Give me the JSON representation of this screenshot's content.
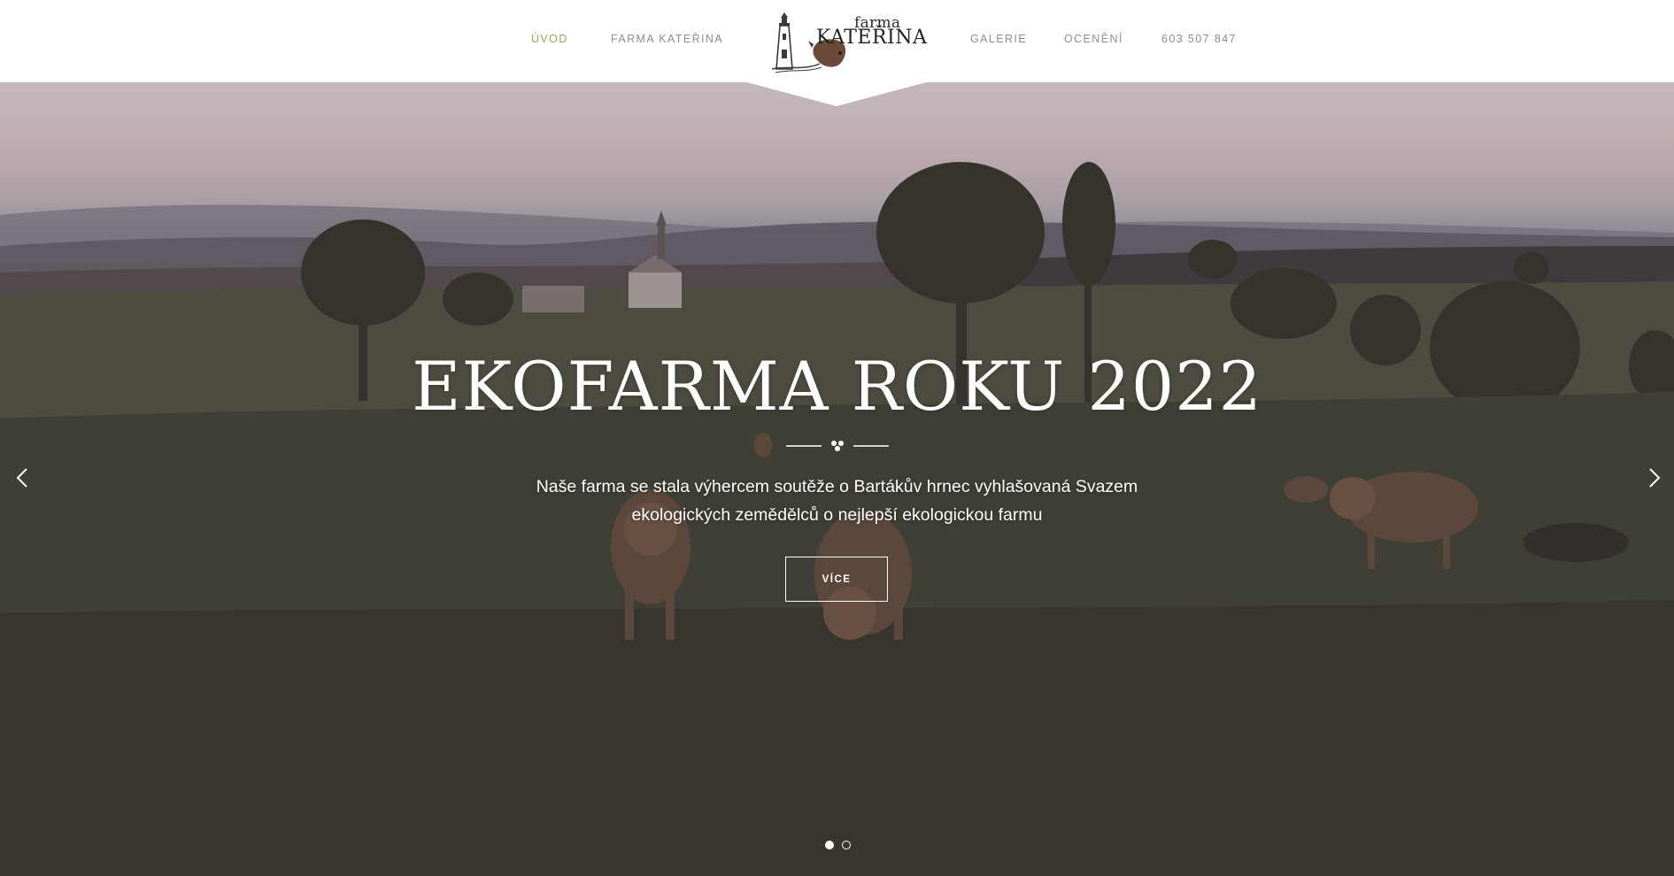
{
  "nav": {
    "items": [
      {
        "label": "ÚVOD",
        "active": true
      },
      {
        "label": "FARMA KATEŘINA",
        "active": false
      },
      {
        "label": "GALERIE",
        "active": false
      },
      {
        "label": "OCENĚNÍ",
        "active": false
      },
      {
        "label": "603 507 847",
        "active": false
      }
    ],
    "active_color": "#a79a63",
    "inactive_color": "#8e8e8e"
  },
  "logo": {
    "small": "farma",
    "big": "KATEŘINA",
    "icons": [
      "lighthouse-icon",
      "cow-head-icon"
    ]
  },
  "hero": {
    "title": "EKOFARMA ROKU 2022",
    "text": "Naše farma se stala výhercem soutěže o Bartákův hrnec vyhlašovaná Svazem ekologických zemědělců o nejlepší ekologickou farmu",
    "button_label": "VÍCE",
    "slides_total": 2,
    "active_slide": 1,
    "background": "photo of cows grazing on a hilly pasture at dusk, village church and trees in the distance"
  }
}
